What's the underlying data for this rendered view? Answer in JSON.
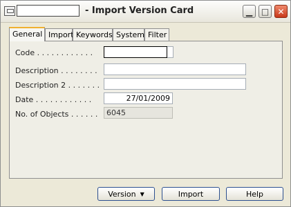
{
  "window": {
    "title": "- Import Version Card",
    "title_field_value": ""
  },
  "tabs": [
    {
      "label": "General",
      "active": true
    },
    {
      "label": "Import"
    },
    {
      "label": "Keywords"
    },
    {
      "label": "System"
    },
    {
      "label": "Filter"
    }
  ],
  "form": {
    "code": {
      "label": "Code . . . . . . . . . . . .",
      "value": ""
    },
    "description": {
      "label": "Description . . . . . . . .",
      "value": ""
    },
    "description2": {
      "label": "Description 2 . . . . . . .",
      "value": ""
    },
    "date": {
      "label": "Date . . . . . . . . . . . .",
      "value": "27/01/2009"
    },
    "objects": {
      "label": "No. of Objects . . . . . .",
      "value": "6045"
    }
  },
  "buttons": {
    "version": "Version",
    "import": "Import",
    "help": "Help"
  },
  "icons": {
    "app": "card-icon",
    "min": "minimize-icon",
    "max": "maximize-icon",
    "close": "close-icon",
    "dropdown": "chevron-down-icon"
  }
}
